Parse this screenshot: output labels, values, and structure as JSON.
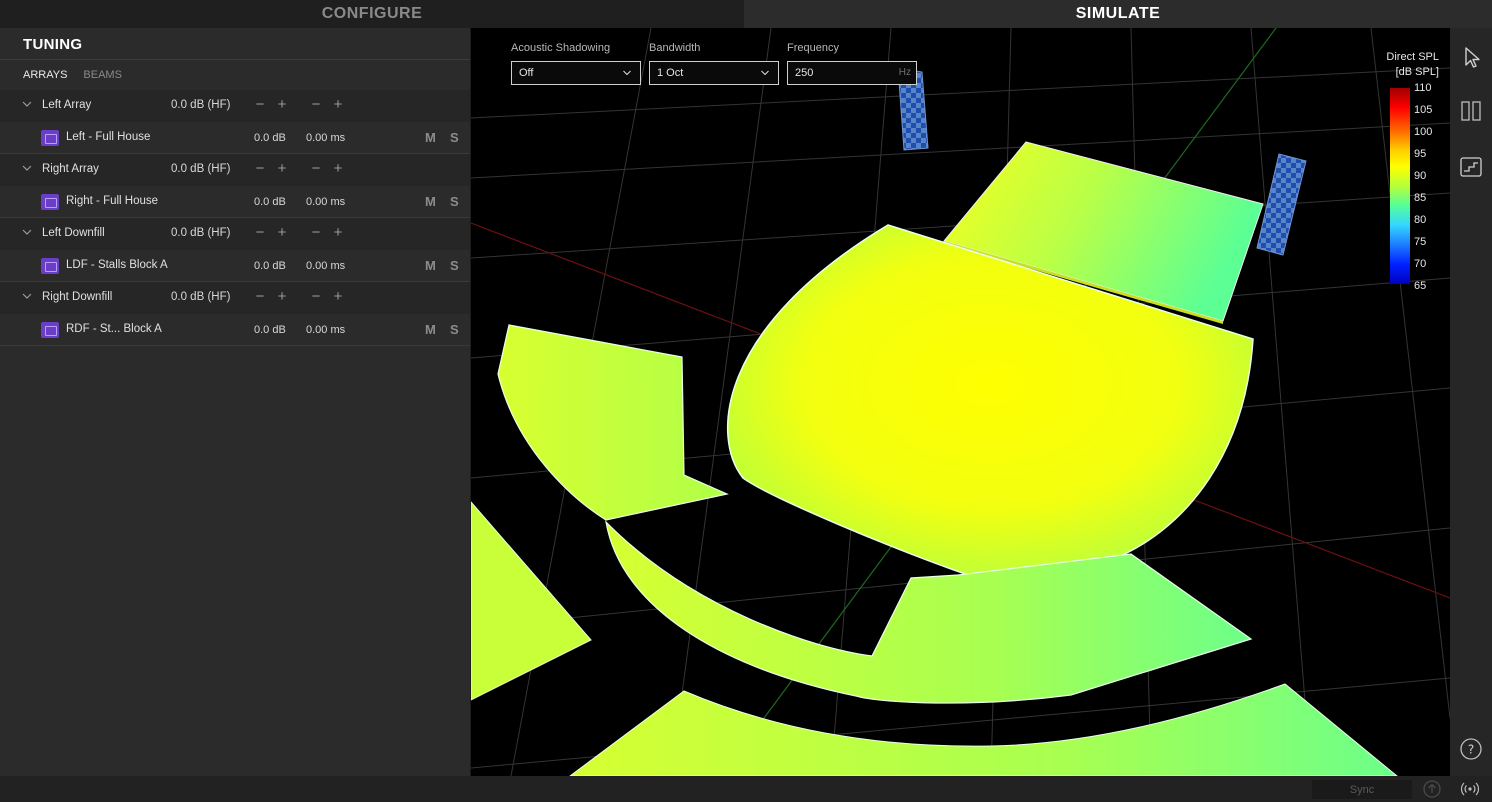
{
  "tabs": {
    "configure": "CONFIGURE",
    "simulate": "SIMULATE"
  },
  "panel": {
    "title": "TUNING",
    "subtabs": [
      "ARRAYS",
      "BEAMS"
    ],
    "mute_label": "M",
    "solo_label": "S",
    "groups": [
      {
        "name": "Left Array",
        "gain": "0.0 dB (HF)",
        "child": {
          "name": "Left - Full House",
          "gain": "0.0 dB",
          "delay": "0.00 ms"
        }
      },
      {
        "name": "Right Array",
        "gain": "0.0 dB (HF)",
        "child": {
          "name": "Right - Full House",
          "gain": "0.0 dB",
          "delay": "0.00 ms"
        }
      },
      {
        "name": "Left Downfill",
        "gain": "0.0 dB (HF)",
        "child": {
          "name": "LDF - Stalls Block A",
          "gain": "0.0 dB",
          "delay": "0.00 ms"
        }
      },
      {
        "name": "Right Downfill",
        "gain": "0.0 dB (HF)",
        "child": {
          "name": "RDF - St... Block A",
          "gain": "0.0 dB",
          "delay": "0.00 ms"
        }
      }
    ]
  },
  "controls": {
    "acoustic_shadowing": {
      "label": "Acoustic Shadowing",
      "value": "Off"
    },
    "bandwidth": {
      "label": "Bandwidth",
      "value": "1 Oct"
    },
    "frequency": {
      "label": "Frequency",
      "value": "250",
      "unit": "Hz"
    }
  },
  "legend": {
    "title_line1": "Direct SPL",
    "title_line2": "[dB SPL]",
    "ticks": [
      "110",
      "105",
      "100",
      "95",
      "90",
      "85",
      "80",
      "75",
      "70",
      "65"
    ],
    "max": 110,
    "min": 65
  },
  "statusbar": {
    "sync_label": "Sync"
  },
  "colors": {
    "accent": "#6a3fc8",
    "panel_bg": "#2b2b2b",
    "viewport_bg": "#000000"
  },
  "icons": {
    "pointer": "cursor-arrow-icon",
    "split": "split-view-icon",
    "layers": "layers-icon",
    "help": "help-icon",
    "upload": "upload-icon",
    "broadcast": "broadcast-icon"
  }
}
